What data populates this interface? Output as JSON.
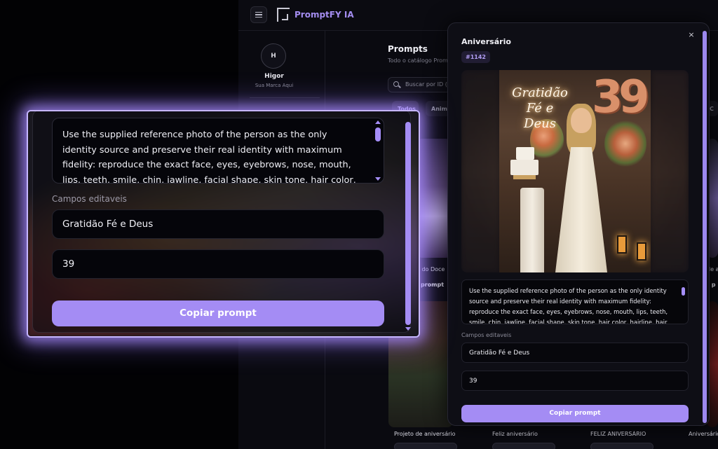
{
  "header": {
    "brand": "PromptFY IA"
  },
  "sidebar": {
    "avatar_initial": "H",
    "user_name": "Higor",
    "user_subtitle": "Sua Marca Aqui"
  },
  "main": {
    "title": "Prompts",
    "subtitle": "Todo o catálogo Prom",
    "search_placeholder": "Buscar por ID (",
    "chips": [
      "Todos",
      "Anime",
      "C"
    ],
    "card_labels": [
      "o do Doce",
      "de a"
    ],
    "card_buttons": [
      "prompt",
      "r p"
    ],
    "cards": [
      {
        "title": "Projeto de aniversário"
      },
      {
        "title": "Feliz aniversário"
      },
      {
        "title": "FELIZ ANIVERSÁRIO"
      },
      {
        "title": "Aniversário"
      }
    ]
  },
  "modal": {
    "title": "Aniversário",
    "id_badge": "#1142",
    "close_glyph": "×",
    "image_text": {
      "neon_line1": "Gratidão",
      "neon_line2": "Fé e Deus",
      "balloon_digit1": "3",
      "balloon_digit2": "9"
    },
    "prompt_text": "Use the supplied reference photo of the person as the only identity source and preserve their real identity with maximum fidelity: reproduce the exact face, eyes, eyebrows, nose, mouth, lips, teeth, smile, chin, jawline, facial shape, skin tone, hair color, hairline, hair texture, hair",
    "editable_label": "Campos editaveis",
    "fields": [
      "Gratidão Fé e Deus",
      "39"
    ],
    "copy_button": "Copiar prompt"
  },
  "zoom": {
    "prompt_text": "Use the supplied reference photo of the person as the only identity source and preserve their real identity with maximum fidelity: reproduce the exact face, eyes, eyebrows, nose, mouth, lips, teeth, smile, chin, jawline, facial shape, skin tone, hair color, hairline, hair texture, hair",
    "editable_label": "Campos editaveis",
    "fields": [
      "Gratidão Fé e Deus",
      "39"
    ],
    "copy_button": "Copiar prompt"
  },
  "colors": {
    "accent": "#a48cf4",
    "glow": "#c6b6ff",
    "background": "#0a0a10"
  }
}
